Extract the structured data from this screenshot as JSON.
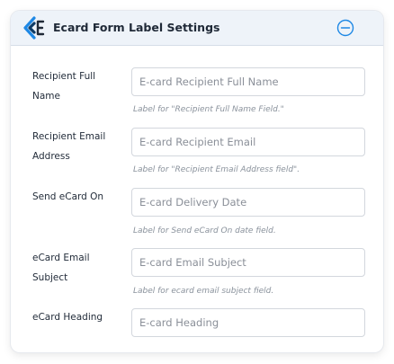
{
  "header": {
    "title": "Ecard Form Label Settings",
    "logo_icon": "brand-logo-icon",
    "collapse_icon": "minus-circle-icon",
    "accent_color": "#1e88e5"
  },
  "fields": [
    {
      "label": "Recipient Full Name",
      "placeholder": "E-card Recipient Full Name",
      "value": "",
      "help": "Label for \"Recipient Full Name Field.\""
    },
    {
      "label": "Recipient Email Address",
      "placeholder": "E-card Recipient Email",
      "value": "",
      "help": "Label for \"Recipient Email Address field\"."
    },
    {
      "label": "Send eCard On",
      "placeholder": "E-card Delivery Date",
      "value": "",
      "help": "Label for Send eCard On date field."
    },
    {
      "label": "eCard Email Subject",
      "placeholder": "E-card Email Subject",
      "value": "",
      "help": "Label for ecard email subject field."
    },
    {
      "label": "eCard Heading",
      "placeholder": "E-card Heading",
      "value": "",
      "help": ""
    }
  ]
}
